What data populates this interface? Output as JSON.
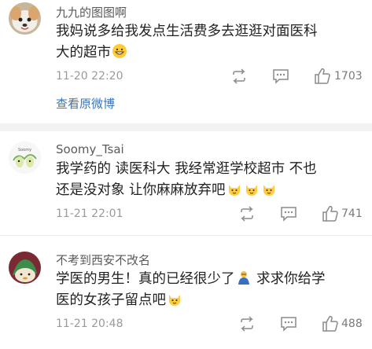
{
  "comments": [
    {
      "username": "九九的图图啊",
      "text_line1": "我妈说多给我发点生活费多去逛逛对面医科",
      "text_line2": "大的超市",
      "time": "11-20 22:20",
      "likes": "1703",
      "view_original": "查看原微博"
    },
    {
      "username": "Soomy_Tsai",
      "text_line1": "我学药的 读医科大 我经常逛学校超市 不也",
      "text_line2": "还是没对象 让你麻麻放弃吧",
      "time": "11-21 22:01",
      "likes": "741"
    },
    {
      "username": "不考到西安不改名",
      "text_line1": "学医的男生！真的已经很少了",
      "text_line1b": " 求求你给学",
      "text_line2": "医的女孩子留点吧",
      "time": "11-21 20:48",
      "likes": "488"
    }
  ],
  "colors": {
    "link": "#3b74b8",
    "separator": "#f2f2f2",
    "meta": "#9a9a9a"
  },
  "icons": [
    "repost-icon",
    "comment-icon",
    "thumbs-up-icon",
    "grinning-emoji",
    "cat-face-emoji",
    "person-bowing-emoji"
  ]
}
